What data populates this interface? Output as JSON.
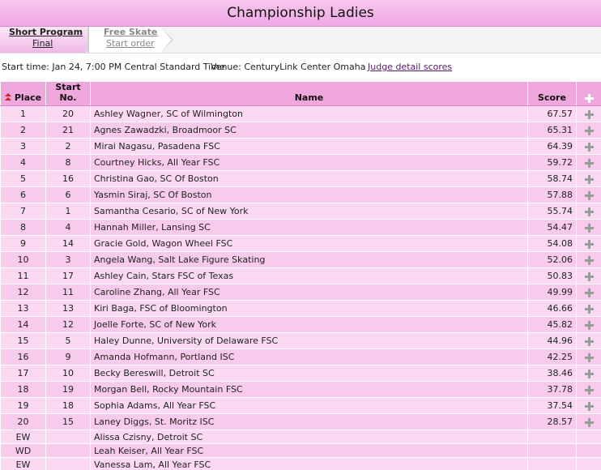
{
  "title": "Championship Ladies",
  "tabs": {
    "short_program": {
      "title": "Short Program",
      "sub": "Final"
    },
    "free_skate": {
      "title": "Free Skate",
      "sub": "Start order"
    }
  },
  "info": {
    "start_time": "Start time: Jan 24, 7:00 PM Central Standard Time",
    "venue": "Venue: CenturyLink Center Omaha",
    "judge_link": "Judge detail scores"
  },
  "table": {
    "headers": {
      "place": "Place",
      "start_no": "Start No.",
      "name": "Name",
      "score": "Score"
    },
    "rows": [
      {
        "place": "1",
        "start": "20",
        "name": "Ashley Wagner, SC of Wilmington",
        "score": "67.57"
      },
      {
        "place": "2",
        "start": "21",
        "name": "Agnes Zawadzki, Broadmoor SC",
        "score": "65.31"
      },
      {
        "place": "3",
        "start": "2",
        "name": "Mirai Nagasu, Pasadena FSC",
        "score": "64.39"
      },
      {
        "place": "4",
        "start": "8",
        "name": "Courtney Hicks, All Year FSC",
        "score": "59.72"
      },
      {
        "place": "5",
        "start": "16",
        "name": "Christina Gao, SC Of Boston",
        "score": "58.74"
      },
      {
        "place": "6",
        "start": "6",
        "name": "Yasmin Siraj, SC Of Boston",
        "score": "57.88"
      },
      {
        "place": "7",
        "start": "1",
        "name": "Samantha Cesario, SC of New York",
        "score": "55.74"
      },
      {
        "place": "8",
        "start": "4",
        "name": "Hannah Miller, Lansing SC",
        "score": "54.47"
      },
      {
        "place": "9",
        "start": "14",
        "name": "Gracie Gold, Wagon Wheel FSC",
        "score": "54.08"
      },
      {
        "place": "10",
        "start": "3",
        "name": "Angela Wang, Salt Lake Figure Skating",
        "score": "52.06"
      },
      {
        "place": "11",
        "start": "17",
        "name": "Ashley Cain, Stars FSC of Texas",
        "score": "50.83"
      },
      {
        "place": "12",
        "start": "11",
        "name": "Caroline Zhang, All Year FSC",
        "score": "49.99"
      },
      {
        "place": "13",
        "start": "13",
        "name": "Kiri Baga, FSC of Bloomington",
        "score": "46.66"
      },
      {
        "place": "14",
        "start": "12",
        "name": "Joelle Forte, SC of New York",
        "score": "45.82"
      },
      {
        "place": "15",
        "start": "5",
        "name": "Haley Dunne, University of Delaware FSC",
        "score": "44.96"
      },
      {
        "place": "16",
        "start": "9",
        "name": "Amanda Hofmann, Portland ISC",
        "score": "42.25"
      },
      {
        "place": "17",
        "start": "10",
        "name": "Becky Bereswill, Detroit SC",
        "score": "38.46"
      },
      {
        "place": "18",
        "start": "19",
        "name": "Morgan Bell, Rocky Mountain FSC",
        "score": "37.78"
      },
      {
        "place": "19",
        "start": "18",
        "name": "Sophia Adams, All Year FSC",
        "score": "37.54"
      },
      {
        "place": "20",
        "start": "15",
        "name": "Laney Diggs, St. Moritz ISC",
        "score": "28.57"
      }
    ],
    "withdrawn": [
      {
        "place": "EW",
        "start": "",
        "name": "Alissa Czisny, Detroit SC",
        "score": ""
      },
      {
        "place": "WD",
        "start": "",
        "name": "Leah Keiser, All Year FSC",
        "score": ""
      },
      {
        "place": "EW",
        "start": "",
        "name": "Vanessa Lam, All Year FSC",
        "score": ""
      }
    ]
  },
  "icons": {
    "sort": "sort-ascending-icon",
    "expand": "plus-icon"
  },
  "colors": {
    "header_pink": "#f0a7dd",
    "row_light": "#fbd9f2",
    "row_dark": "#f8cbec",
    "sort_red": "#d42020"
  }
}
